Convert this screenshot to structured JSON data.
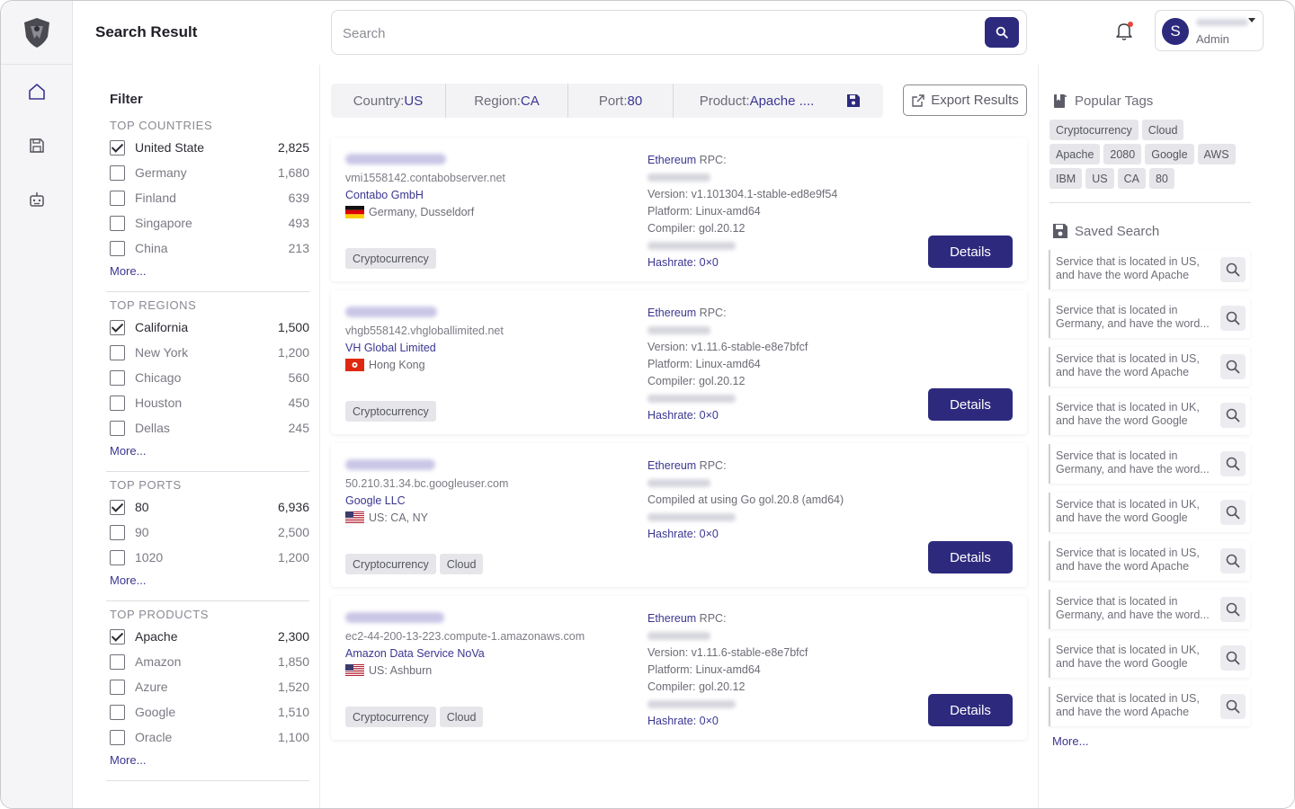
{
  "header": {
    "title": "Search Result",
    "search_placeholder": "Search",
    "user_initial": "S",
    "user_role": "Admin"
  },
  "filter": {
    "title": "Filter",
    "sections": [
      {
        "title": "TOP COUNTRIES",
        "items": [
          {
            "label": "United State",
            "count": "2,825",
            "checked": true
          },
          {
            "label": "Germany",
            "count": "1,680",
            "checked": false
          },
          {
            "label": "Finland",
            "count": "639",
            "checked": false
          },
          {
            "label": "Singapore",
            "count": "493",
            "checked": false
          },
          {
            "label": "China",
            "count": "213",
            "checked": false
          }
        ],
        "more": "More..."
      },
      {
        "title": "TOP REGIONS",
        "items": [
          {
            "label": "California",
            "count": "1,500",
            "checked": true
          },
          {
            "label": "New York",
            "count": "1,200",
            "checked": false
          },
          {
            "label": "Chicago",
            "count": "560",
            "checked": false
          },
          {
            "label": "Houston",
            "count": "450",
            "checked": false
          },
          {
            "label": "Dellas",
            "count": "245",
            "checked": false
          }
        ],
        "more": "More..."
      },
      {
        "title": "TOP PORTS",
        "items": [
          {
            "label": "80",
            "count": "6,936",
            "checked": true
          },
          {
            "label": "90",
            "count": "2,500",
            "checked": false
          },
          {
            "label": "1020",
            "count": "1,200",
            "checked": false
          }
        ],
        "more": "More..."
      },
      {
        "title": "TOP PRODUCTS",
        "items": [
          {
            "label": "Apache",
            "count": "2,300",
            "checked": true
          },
          {
            "label": "Amazon",
            "count": "1,850",
            "checked": false
          },
          {
            "label": "Azure",
            "count": "1,520",
            "checked": false
          },
          {
            "label": "Google",
            "count": "1,510",
            "checked": false
          },
          {
            "label": "Oracle",
            "count": "1,100",
            "checked": false
          }
        ],
        "more": "More..."
      }
    ]
  },
  "chips": [
    {
      "key": "Country: ",
      "value": "US"
    },
    {
      "key": "Region: ",
      "value": "CA"
    },
    {
      "key": "Port: ",
      "value": "80"
    },
    {
      "key": "Product: ",
      "value": "Apache ...."
    }
  ],
  "export_label": "Export Results",
  "results": [
    {
      "host": "vmi1558142.contabobserver.net",
      "org": "Contabo GmbH",
      "flag": "de",
      "location": "Germany, Dusseldorf",
      "tags": [
        "Cryptocurrency"
      ],
      "rpc_label": "Ethereum",
      "rpc_suffix": " RPC:",
      "lines": [
        {
          "text": "",
          "blur": true
        },
        {
          "text": "Version: v1.101304.1-stable-ed8e9f54",
          "blur": false
        },
        {
          "text": "Platform: Linux-amd64",
          "blur": false
        },
        {
          "text": "Compiler: gol.20.12",
          "blur": false
        },
        {
          "text": "",
          "blur": true
        }
      ],
      "hashrate": "Hashrate: 0×0",
      "details": "Details"
    },
    {
      "host": "vhgb558142.vhgloballimited.net",
      "org": "VH Global Limited",
      "flag": "hk",
      "location": "Hong Kong",
      "tags": [
        "Cryptocurrency"
      ],
      "rpc_label": "Ethereum",
      "rpc_suffix": " RPC:",
      "lines": [
        {
          "text": "",
          "blur": true
        },
        {
          "text": "Version: v1.11.6-stable-e8e7bfcf",
          "blur": false
        },
        {
          "text": "Platform: Linux-amd64",
          "blur": false
        },
        {
          "text": "Compiler: gol.20.12",
          "blur": false
        },
        {
          "text": "",
          "blur": true
        }
      ],
      "hashrate": "Hashrate: 0×0",
      "details": "Details"
    },
    {
      "host": "50.210.31.34.bc.googleuser.com",
      "org": "Google LLC",
      "flag": "us",
      "location": "US: CA, NY",
      "tags": [
        "Cryptocurrency",
        "Cloud"
      ],
      "rpc_label": "Ethereum",
      "rpc_suffix": " RPC:",
      "lines": [
        {
          "text": "",
          "blur": true
        },
        {
          "text": "Compiled at using Go gol.20.8 (amd64)",
          "blur": false
        },
        {
          "text": "",
          "blur": true
        }
      ],
      "hashrate": "Hashrate: 0×0",
      "details": "Details"
    },
    {
      "host": "ec2-44-200-13-223.compute-1.amazonaws.com",
      "org": "Amazon Data Service NoVa",
      "flag": "us",
      "location": "US: Ashburn",
      "tags": [
        "Cryptocurrency",
        "Cloud"
      ],
      "rpc_label": "Ethereum",
      "rpc_suffix": " RPC:",
      "lines": [
        {
          "text": "",
          "blur": true
        },
        {
          "text": "Version: v1.11.6-stable-e8e7bfcf",
          "blur": false
        },
        {
          "text": "Platform: Linux-amd64",
          "blur": false
        },
        {
          "text": "Compiler: gol.20.12",
          "blur": false
        },
        {
          "text": "",
          "blur": true
        }
      ],
      "hashrate": "Hashrate: 0×0",
      "details": "Details"
    }
  ],
  "popular_tags": {
    "title": "Popular Tags",
    "rows": [
      [
        "Cryptocurrency",
        "Cloud"
      ],
      [
        "Apache",
        "2080",
        "Google",
        "AWS"
      ],
      [
        "IBM",
        "US",
        "CA",
        "80"
      ]
    ]
  },
  "saved_search": {
    "title": "Saved Search",
    "items": [
      "Service that is located in US, and have the word Apache",
      "Service that is located in Germany, and have the word...",
      "Service that is located in US, and have the word Apache",
      "Service that is located in UK, and have the word Google",
      "Service that is located in Germany, and have the word...",
      "Service that is located in UK, and have the word Google",
      "Service that is located in US, and have the word Apache",
      "Service that is located in Germany, and have the word...",
      "Service that is located in UK, and have the word Google",
      "Service that is located in US, and have the word Apache"
    ],
    "more": "More..."
  },
  "colors": {
    "accent": "#2d2a7e",
    "link": "#3b3691"
  }
}
